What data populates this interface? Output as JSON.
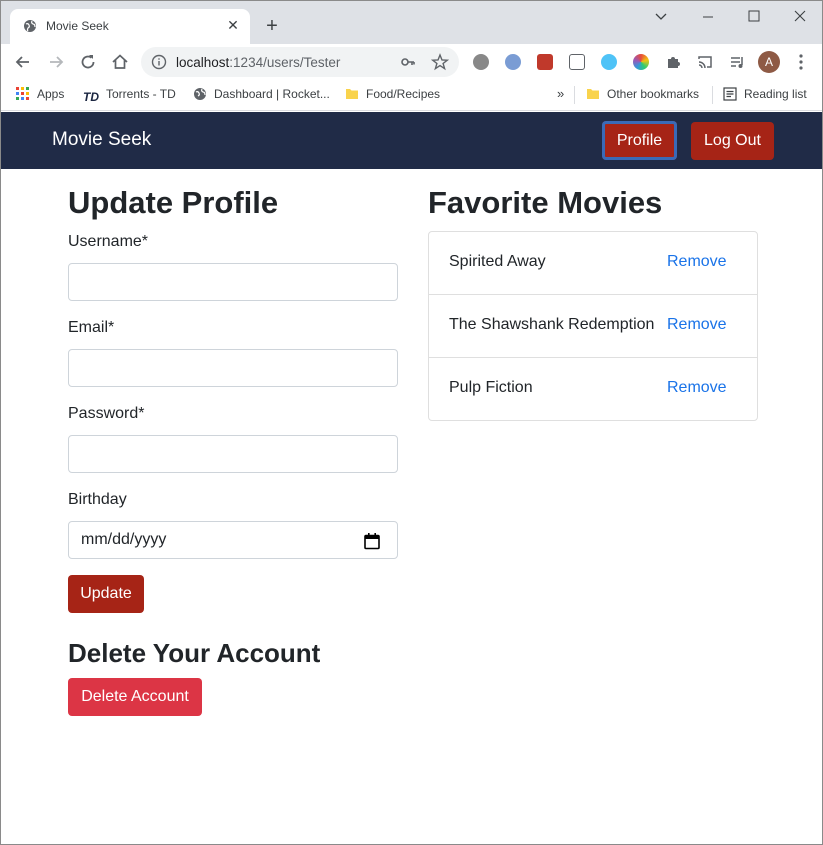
{
  "browser": {
    "tab_title": "Movie Seek",
    "url_host": "localhost",
    "url_path": ":1234/users/Tester",
    "avatar_letter": "A",
    "bookmarks": {
      "apps": "Apps",
      "torrents": "Torrents - TD",
      "dashboard": "Dashboard | Rocket...",
      "food": "Food/Recipes",
      "overflow": "»",
      "other": "Other bookmarks",
      "reading": "Reading list"
    }
  },
  "navbar": {
    "brand": "Movie Seek",
    "profile_label": "Profile",
    "logout_label": "Log Out"
  },
  "update_profile": {
    "heading": "Update Profile",
    "username_label": "Username*",
    "email_label": "Email*",
    "password_label": "Password*",
    "birthday_label": "Birthday",
    "birthday_placeholder": "mm/dd/yyyy",
    "update_label": "Update"
  },
  "delete_account": {
    "heading": "Delete Your Account",
    "button_label": "Delete Account"
  },
  "favorites": {
    "heading": "Favorite Movies",
    "remove_label": "Remove",
    "movies": [
      "Spirited Away",
      "The Shawshank Redemption",
      "Pulp Fiction"
    ]
  },
  "colors": {
    "navbar": "#202b47",
    "primary_button": "#a62416",
    "danger_button": "#dc3545",
    "link": "#1a73e8"
  },
  "icons": [
    "globe-icon",
    "close-icon",
    "plus-icon",
    "minimize-icon",
    "maximize-icon",
    "window-close-icon",
    "back-arrow-icon",
    "forward-arrow-icon",
    "reload-icon",
    "home-icon",
    "info-icon",
    "key-icon",
    "star-icon",
    "puzzle-icon",
    "cast-icon",
    "media-icon",
    "kebab-menu-icon",
    "calendar-icon",
    "folder-icon",
    "apps-grid-icon",
    "reading-list-icon"
  ]
}
